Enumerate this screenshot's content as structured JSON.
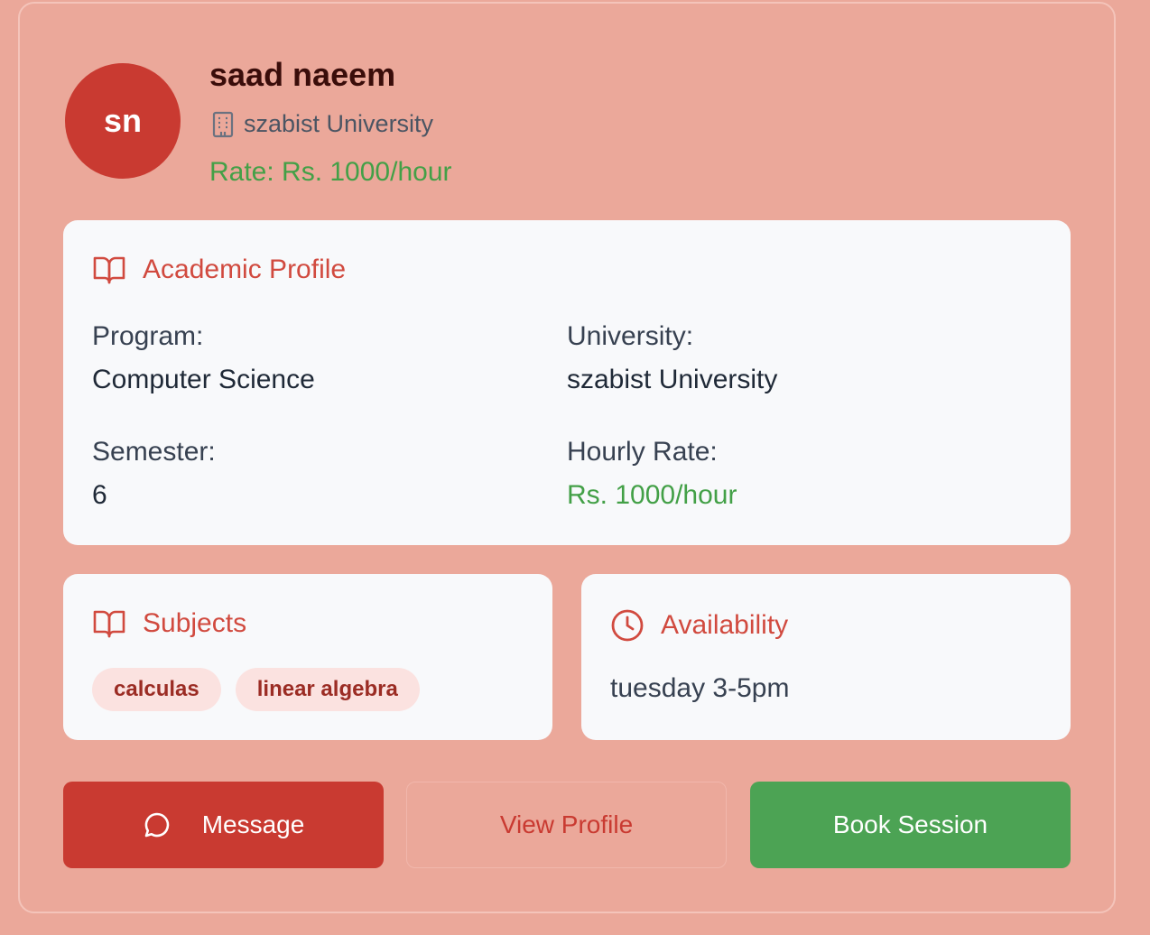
{
  "tutor": {
    "initials": "sn",
    "name": "saad naeem",
    "university": "szabist University",
    "rate_text": "Rate: Rs. 1000/hour"
  },
  "academic": {
    "title": "Academic Profile",
    "program_label": "Program:",
    "program_value": "Computer Science",
    "university_label": "University:",
    "university_value": "szabist University",
    "semester_label": "Semester:",
    "semester_value": "6",
    "hourly_label": "Hourly Rate:",
    "hourly_value": "Rs. 1000/hour"
  },
  "subjects": {
    "title": "Subjects",
    "items": [
      "calculas",
      "linear algebra"
    ]
  },
  "availability": {
    "title": "Availability",
    "text": "tuesday 3-5pm"
  },
  "actions": {
    "message": "Message",
    "view_profile": "View Profile",
    "book_session": "Book Session"
  },
  "colors": {
    "background": "#eba89a",
    "primary_red": "#c93a31",
    "accent_green": "#4ca354",
    "panel": "#f8f9fb"
  },
  "icons": {
    "university": "building-icon",
    "academic": "book-open-icon",
    "subjects": "book-open-icon",
    "availability": "clock-icon",
    "message": "chat-bubble-icon"
  }
}
